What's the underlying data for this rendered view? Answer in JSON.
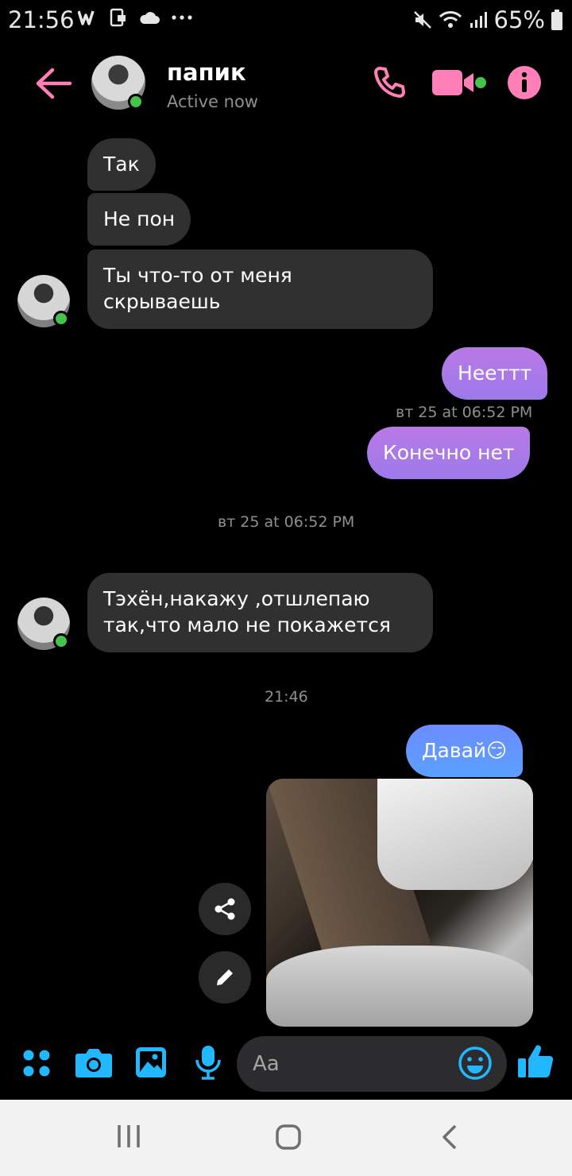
{
  "status_bar": {
    "time": "21:56",
    "battery": "65%",
    "icons": [
      "w-app-icon",
      "screenshot-icon",
      "cloud-icon",
      "more-dots-icon",
      "mute-icon",
      "wifi-icon",
      "signal-icon",
      "battery-icon"
    ]
  },
  "header": {
    "name": "папик",
    "status": "Active now",
    "accent_color": "#ff7fb6"
  },
  "messages": {
    "in1": "Так",
    "in2": "Не пон",
    "in3_line1": "Ты что-то от меня",
    "in3_line2": "скрываешь",
    "out1": "Нееттт",
    "ts1": "вт 25 at 06:52 PM",
    "out2": "Конечно нет",
    "ts2": "вт 25 at 06:52 PM",
    "in4_line1": "Тэхён,накажу ,отшлепаю",
    "in4_line2": "так,что мало не покажется",
    "ts3": "21:46",
    "out3": "Давай😏"
  },
  "composer": {
    "placeholder": "Aa",
    "icon_color": "#22b8ff"
  }
}
